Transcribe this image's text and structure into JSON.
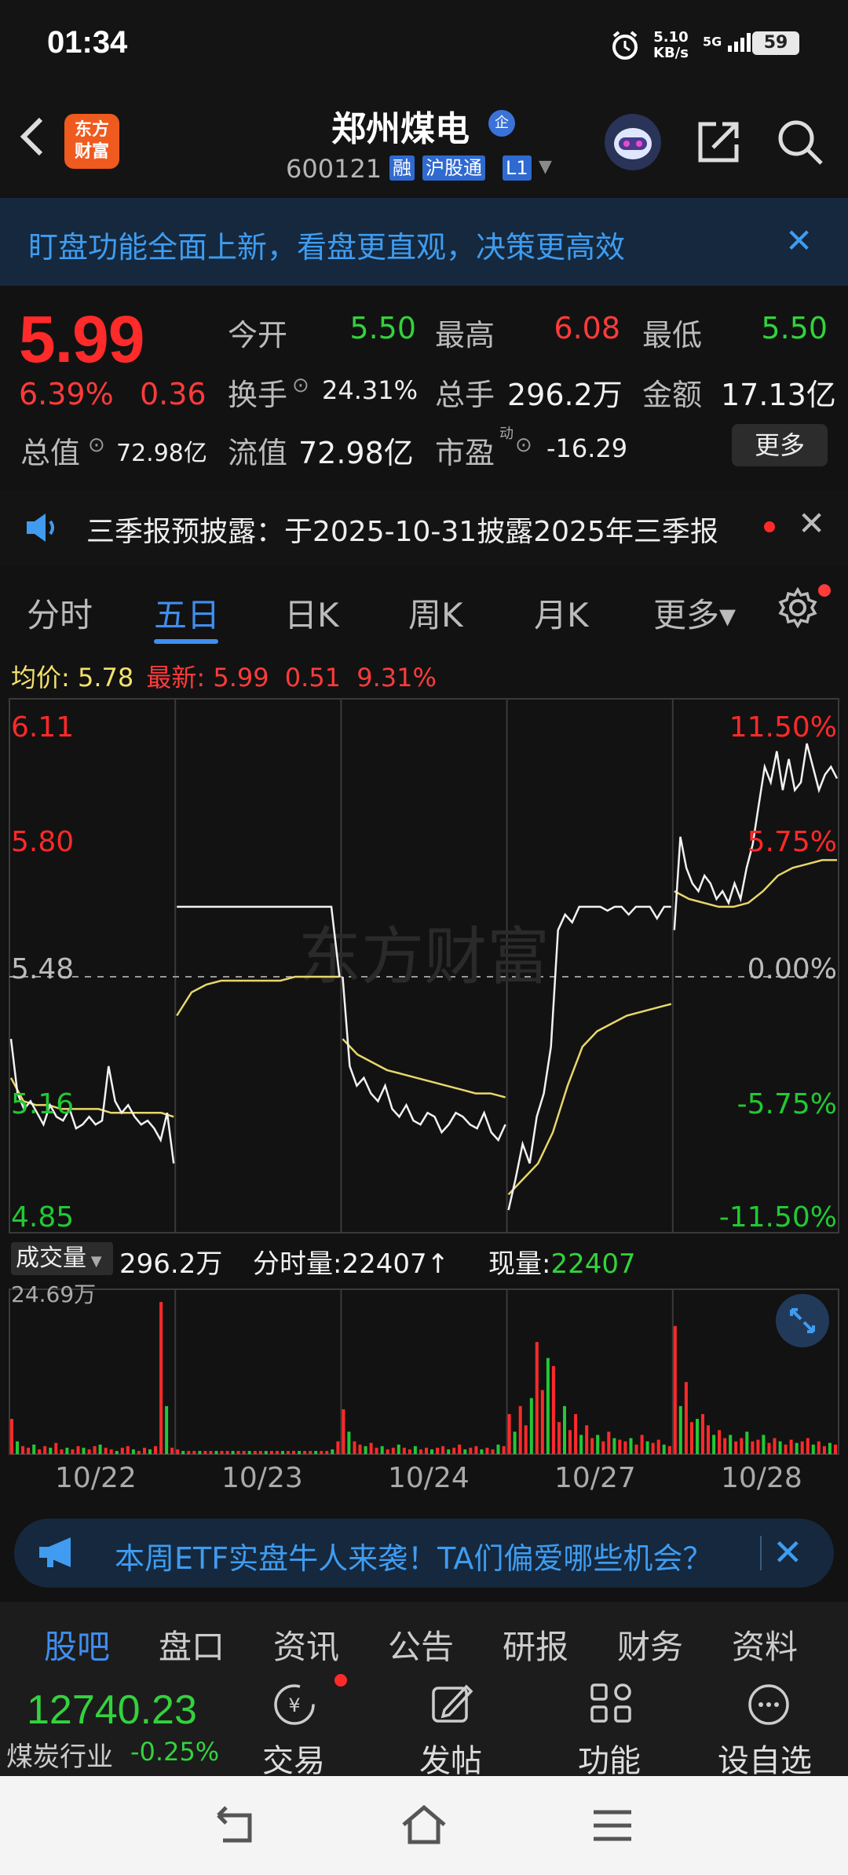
{
  "status": {
    "time": "01:34",
    "net_speed": "5.10",
    "net_unit": "KB/s",
    "signal": "5G",
    "battery": "59"
  },
  "header": {
    "logo_line1": "东方",
    "logo_line2": "财富",
    "stock_name": "郑州煤电",
    "corp_badge": "企",
    "stock_code": "600121",
    "tag_rong": "融",
    "tag_hgt": "沪股通",
    "tag_l1": "L1"
  },
  "banner": {
    "text": "盯盘功能全面上新，看盘更直观，决策更高效",
    "close": "✕"
  },
  "quote": {
    "price": "5.99",
    "change_pct": "6.39%",
    "change_abs": "0.36",
    "open_label": "今开",
    "open": "5.50",
    "high_label": "最高",
    "high": "6.08",
    "low_label": "最低",
    "low": "5.50",
    "turnover_label": "换手",
    "turnover": "24.31%",
    "volume_label": "总手",
    "volume": "296.2万",
    "amount_label": "金额",
    "amount": "17.13亿",
    "mktcap_label": "总值",
    "mktcap": "72.98亿",
    "float_label": "流值",
    "float_cap": "72.98亿",
    "pe_label": "市盈",
    "pe_super": "动",
    "pe": "-16.29",
    "more": "更多"
  },
  "notice": {
    "text": "三季报预披露：于2025-10-31披露2025年三季报",
    "close": "✕"
  },
  "tabs": {
    "t1": "分时",
    "t2": "五日",
    "t3": "日K",
    "t4": "周K",
    "t5": "月K",
    "t6": "更多▾",
    "active": "五日"
  },
  "chart_info": {
    "avg_label": "均价:",
    "avg": "5.78",
    "latest_label": "最新:",
    "latest": "5.99",
    "chg": "0.51",
    "pct": "9.31%"
  },
  "chart_data": {
    "type": "line",
    "watermark": "东方财富",
    "y_left": [
      "6.11",
      "5.80",
      "5.48",
      "5.16",
      "4.85"
    ],
    "y_right": [
      "11.50%",
      "5.75%",
      "0.00%",
      "-5.75%",
      "-11.50%"
    ],
    "ylim": [
      4.85,
      6.11
    ],
    "prev_close": 5.48,
    "x_labels": [
      "10/22",
      "10/23",
      "10/24",
      "10/27",
      "10/28"
    ],
    "colors": {
      "price": "#f2f2f2",
      "avg": "#e8d76a",
      "up": "#ff2a2a",
      "down": "#22c934",
      "grid": "#3a3a3a"
    },
    "price_series": [
      {
        "day": "10/22",
        "values": [
          5.32,
          5.18,
          5.14,
          5.16,
          5.13,
          5.1,
          5.15,
          5.12,
          5.11,
          5.14,
          5.09,
          5.1,
          5.12,
          5.1,
          5.11,
          5.25,
          5.16,
          5.13,
          5.15,
          5.12,
          5.1,
          5.11,
          5.09,
          5.06,
          5.13,
          5.0
        ]
      },
      {
        "day": "10/23",
        "values": [
          5.66,
          5.66,
          5.66,
          5.66,
          5.66,
          5.66,
          5.66,
          5.66,
          5.66,
          5.66,
          5.66,
          5.66,
          5.66,
          5.66,
          5.66,
          5.66,
          5.66,
          5.66,
          5.66,
          5.66,
          5.48
        ]
      },
      {
        "day": "10/24",
        "values": [
          5.48,
          5.25,
          5.2,
          5.22,
          5.18,
          5.16,
          5.2,
          5.14,
          5.12,
          5.15,
          5.11,
          5.1,
          5.13,
          5.12,
          5.08,
          5.1,
          5.13,
          5.12,
          5.1,
          5.09,
          5.13,
          5.08,
          5.06,
          5.1
        ]
      },
      {
        "day": "10/27",
        "values": [
          4.88,
          4.96,
          5.05,
          5.0,
          5.12,
          5.18,
          5.3,
          5.6,
          5.64,
          5.62,
          5.66,
          5.66,
          5.66,
          5.66,
          5.65,
          5.66,
          5.66,
          5.64,
          5.66,
          5.66,
          5.66,
          5.63,
          5.66,
          5.66
        ]
      },
      {
        "day": "10/28",
        "values": [
          5.6,
          5.84,
          5.76,
          5.72,
          5.7,
          5.74,
          5.72,
          5.68,
          5.7,
          5.67,
          5.72,
          5.68,
          5.76,
          5.82,
          5.92,
          6.02,
          5.98,
          6.06,
          5.96,
          6.04,
          5.96,
          5.98,
          6.08,
          6.02,
          5.96,
          6.0,
          6.02,
          5.99
        ]
      }
    ],
    "avg_series": [
      {
        "day": "10/22",
        "values": [
          5.22,
          5.16,
          5.15,
          5.15,
          5.14,
          5.14,
          5.14,
          5.14,
          5.13,
          5.13,
          5.13,
          5.13,
          5.13,
          5.12
        ]
      },
      {
        "day": "10/23",
        "values": [
          5.38,
          5.44,
          5.46,
          5.47,
          5.47,
          5.47,
          5.47,
          5.47,
          5.48,
          5.48,
          5.48,
          5.48
        ]
      },
      {
        "day": "10/24",
        "values": [
          5.32,
          5.28,
          5.26,
          5.24,
          5.23,
          5.22,
          5.21,
          5.2,
          5.19,
          5.18,
          5.18,
          5.17
        ]
      },
      {
        "day": "10/27",
        "values": [
          4.92,
          4.96,
          5.0,
          5.08,
          5.2,
          5.3,
          5.34,
          5.36,
          5.38,
          5.39,
          5.4,
          5.41
        ]
      },
      {
        "day": "10/28",
        "values": [
          5.7,
          5.68,
          5.67,
          5.66,
          5.66,
          5.67,
          5.7,
          5.74,
          5.76,
          5.77,
          5.78,
          5.78
        ]
      }
    ]
  },
  "volume": {
    "label": "成交量",
    "total": "296.2万",
    "bar_label": "分时量:",
    "bar_value": "22407",
    "arrow": "↑",
    "current_label": "现量:",
    "current": "22407",
    "max_label": "24.69万",
    "bars": [
      22,
      8,
      5,
      4,
      6,
      3,
      5,
      4,
      7,
      3,
      4,
      3,
      5,
      4,
      3,
      5,
      6,
      4,
      3,
      2,
      4,
      5,
      3,
      2,
      4,
      3,
      5,
      95,
      30,
      4,
      3,
      2,
      2,
      2,
      2,
      2,
      2,
      2,
      2,
      2,
      2,
      2,
      2,
      2,
      2,
      2,
      2,
      2,
      2,
      2,
      2,
      2,
      2,
      2,
      2,
      2,
      2,
      2,
      3,
      8,
      28,
      14,
      8,
      6,
      5,
      7,
      4,
      5,
      3,
      4,
      6,
      4,
      3,
      5,
      3,
      4,
      3,
      4,
      5,
      3,
      4,
      6,
      3,
      4,
      5,
      3,
      4,
      3,
      6,
      5,
      25,
      14,
      30,
      18,
      35,
      70,
      40,
      60,
      55,
      20,
      30,
      15,
      25,
      12,
      18,
      10,
      12,
      8,
      14,
      10,
      9,
      8,
      10,
      6,
      12,
      8,
      7,
      9,
      6,
      5,
      80,
      30,
      45,
      20,
      22,
      25,
      18,
      12,
      15,
      10,
      12,
      8,
      10,
      14,
      8,
      9,
      12,
      7,
      10,
      8,
      6,
      9,
      7,
      8,
      10,
      6,
      8,
      5,
      7,
      6
    ]
  },
  "promo": {
    "text": "本周ETF实盘牛人来袭！TA们偏爱哪些机会？",
    "close": "✕"
  },
  "bottom_tabs": {
    "b1": "股吧",
    "b2": "盘口",
    "b3": "资讯",
    "b4": "公告",
    "b5": "研报",
    "b6": "财务",
    "b7": "资料",
    "active": "股吧"
  },
  "bottom_bar": {
    "index_value": "12740.23",
    "index_name": "煤炭行业",
    "index_change": "-0.25%",
    "trade": "交易",
    "post": "发帖",
    "func": "功能",
    "watch": "设自选"
  }
}
